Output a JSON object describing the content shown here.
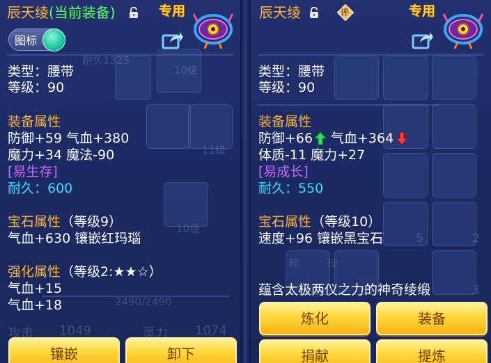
{
  "left": {
    "title": "辰天绫",
    "equipped_tag": "(当前装备)",
    "exclusive": "专用",
    "toggle_label": "图标",
    "type_line": "类型：腰带",
    "level_line": "等级：90",
    "attr_header": "装备属性",
    "attr_line1": "防御+59 气血+380",
    "attr_line2": "魔力+34 魔法-90",
    "special": "[易生存]",
    "durability": "耐久：600",
    "gem_header": "宝石属性",
    "gem_level": "（等级9）",
    "gem_line": "气血+630 镶嵌红玛瑙",
    "enh_header": "强化属性",
    "enh_level": "（等级2:★★☆）",
    "enh_line1": "气血+15",
    "enh_line2": "气血+18",
    "buttons": [
      "镶嵌",
      "卸下"
    ],
    "bg_ghost": {
      "level10a": "10级",
      "level11": "11级",
      "level10b": "10级",
      "hp": "2490/2490",
      "attack": "攻击",
      "attack_val": "1049",
      "spirit": "灵力",
      "spirit_val": "1074",
      "dur": "耐久1325"
    }
  },
  "right": {
    "title": "辰天绫",
    "ping": "评",
    "exclusive": "专用",
    "type_line": "类型：腰带",
    "level_line": "等级：90",
    "attr_header": "装备属性",
    "attr_def": "防御+66",
    "attr_hp": "气血+364",
    "attr_line2": "体质-11 魔力+27",
    "special": "[易成长]",
    "durability": "耐久：550",
    "gem_header": "宝石属性",
    "gem_level": "（等级10）",
    "gem_line": "速度+96 镶嵌黑宝石",
    "description": "蕴含太极两仪之力的神奇绫缎",
    "buttons": [
      "炼化",
      "装备",
      "捐献",
      "提炼"
    ],
    "bg_ghost": {
      "n5": "5",
      "n2": "2",
      "n3": "3",
      "zhen1": "珍",
      "zhen2": "珍"
    }
  },
  "colors": {
    "orange": "#ffb23c",
    "green": "#5fff5f",
    "purple": "#cc66ff",
    "cyan": "#3ed8ff",
    "button": "#ffd73a"
  },
  "icons": [
    "lock-icon",
    "share-icon",
    "belt-emblem-icon",
    "arrow-up-icon",
    "arrow-down-icon",
    "ping-badge-icon"
  ]
}
